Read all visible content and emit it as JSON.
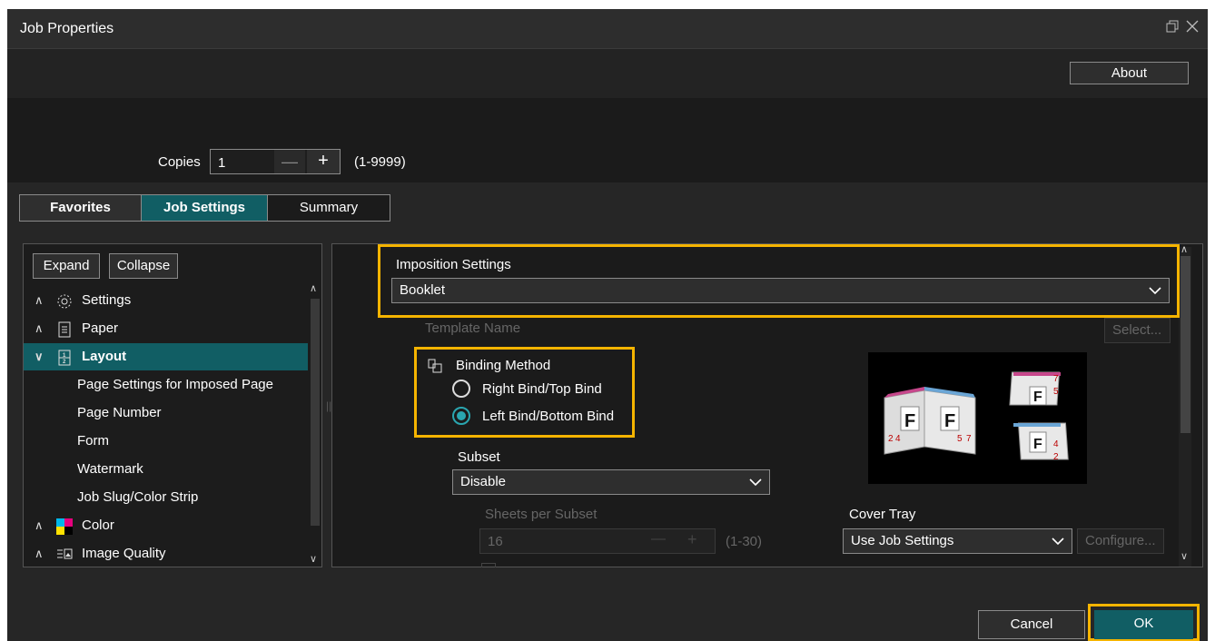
{
  "window": {
    "title": "Job Properties",
    "restore_icon": "restore-icon",
    "close_icon": "close-icon"
  },
  "header": {
    "about_label": "About"
  },
  "copies": {
    "label": "Copies",
    "value": "1",
    "minus": "—",
    "plus": "+",
    "range": "(1-9999)"
  },
  "tabs": [
    {
      "label": "Favorites"
    },
    {
      "label": "Job Settings",
      "selected": true
    },
    {
      "label": "Summary"
    }
  ],
  "tree": {
    "expand_label": "Expand",
    "collapse_label": "Collapse",
    "items": [
      {
        "label": "Settings",
        "icon": "gear-icon"
      },
      {
        "label": "Paper",
        "icon": "paper-icon"
      },
      {
        "label": "Layout",
        "icon": "layout-icon",
        "selected": true
      },
      {
        "label": "Color",
        "icon": "color-icon"
      },
      {
        "label": "Image Quality",
        "icon": "image-quality-icon"
      }
    ],
    "layout_children": [
      "Page Settings for Imposed Page",
      "Page Number",
      "Form",
      "Watermark",
      "Job Slug/Color Strip"
    ]
  },
  "imposition": {
    "label": "Imposition Settings",
    "value": "Booklet"
  },
  "template": {
    "label": "Template Name",
    "select_label": "Select..."
  },
  "binding": {
    "label": "Binding Method",
    "options": [
      {
        "label": "Right Bind/Top Bind",
        "selected": false
      },
      {
        "label": "Left Bind/Bottom Bind",
        "selected": true
      }
    ]
  },
  "subset": {
    "label": "Subset",
    "value": "Disable"
  },
  "sheets_per_subset": {
    "label": "Sheets per Subset",
    "value": "16",
    "range": "(1-30)"
  },
  "cover_tray": {
    "label": "Cover Tray",
    "value": "Use Job Settings",
    "configure_label": "Configure..."
  },
  "preview": {
    "left_pages": [
      "2",
      "4",
      "5",
      "7"
    ],
    "right_pages": [
      "7",
      "5",
      "4",
      "2"
    ],
    "letter": "F"
  },
  "footer": {
    "cancel_label": "Cancel",
    "ok_label": "OK"
  },
  "colors": {
    "accent": "#115e64",
    "highlight": "#f5b400",
    "radio": "#2aa6b0"
  }
}
